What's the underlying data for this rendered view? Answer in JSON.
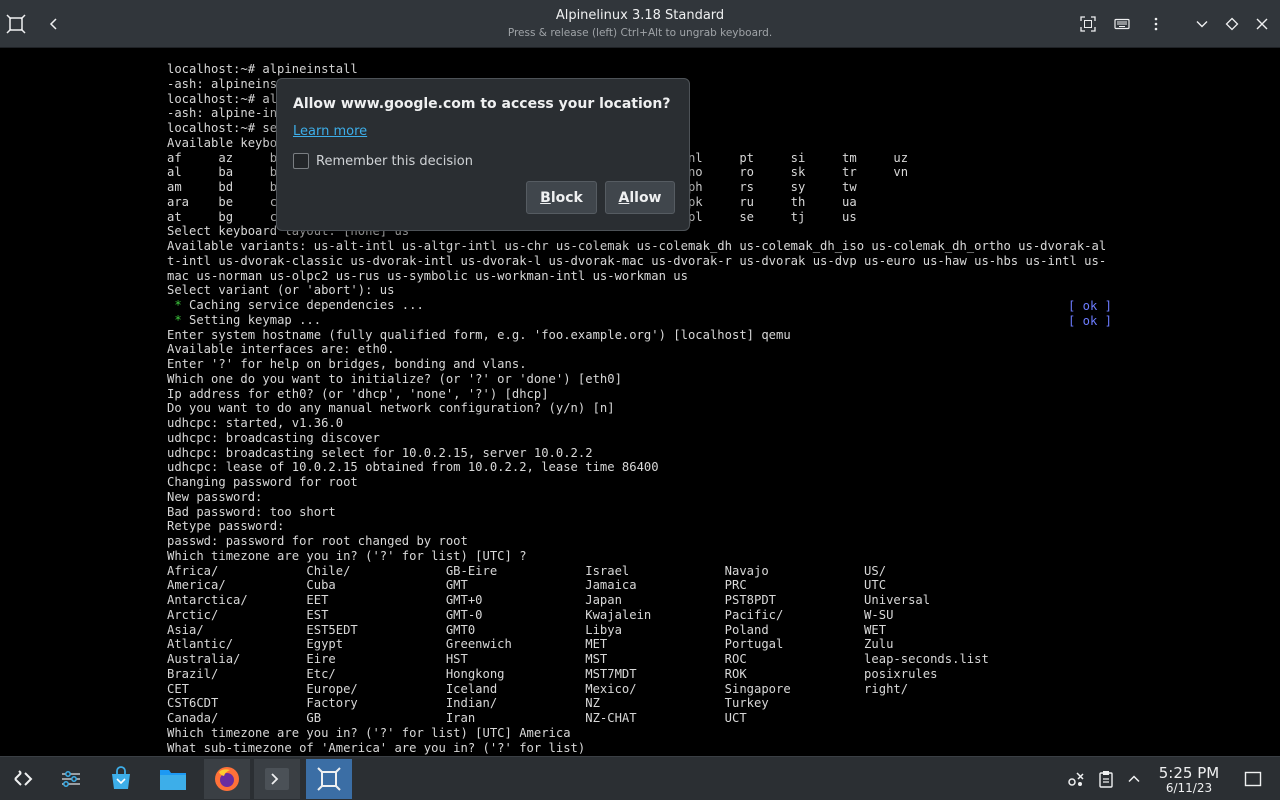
{
  "window": {
    "title": "Alpinelinux 3.18 Standard",
    "subtitle": "Press & release (left) Ctrl+Alt to ungrab keyboard."
  },
  "dialog": {
    "title": "Allow www.google.com to access your location?",
    "learn_more": "Learn more",
    "remember": "Remember this decision",
    "block_first": "B",
    "block_rest": "lock",
    "allow_first": "A",
    "allow_rest": "llow"
  },
  "terminal": {
    "lines": [
      "localhost:~# alpineinstall",
      "-ash: alpineins",
      "localhost:~# al",
      "-ash: alpine-in",
      "localhost:~# se",
      "Available keybo",
      "af     az     b                                           v     ml     nl     pt     si     tm     uz",
      "al     ba     b                                           a     mm     no     ro     sk     tr     vn",
      "am     bd     b                                           d     mt     ph     rs     sy     tw",
      "ara    be     c                                           e     my     pk     ru     th     ua",
      "at     bg     c                                           k     ng     pl     se     tj     us",
      "Select keyboard layout: [none] us",
      "Available variants: us-alt-intl us-altgr-intl us-chr us-colemak us-colemak_dh us-colemak_dh_iso us-colemak_dh_ortho us-dvorak-al",
      "t-intl us-dvorak-classic us-dvorak-intl us-dvorak-l us-dvorak-mac us-dvorak-r us-dvorak us-dvp us-euro us-haw us-hbs us-intl us-",
      "mac us-norman us-olpc2 us-rus us-symbolic us-workman-intl us-workman us",
      "Select variant (or 'abort'): us",
      "__STAR__ Caching service dependencies ...",
      "__STAR__ Setting keymap ...",
      "Enter system hostname (fully qualified form, e.g. 'foo.example.org') [localhost] qemu",
      "Available interfaces are: eth0.",
      "Enter '?' for help on bridges, bonding and vlans.",
      "Which one do you want to initialize? (or '?' or 'done') [eth0]",
      "Ip address for eth0? (or 'dhcp', 'none', '?') [dhcp]",
      "Do you want to do any manual network configuration? (y/n) [n]",
      "udhcpc: started, v1.36.0",
      "udhcpc: broadcasting discover",
      "udhcpc: broadcasting select for 10.0.2.15, server 10.0.2.2",
      "udhcpc: lease of 10.0.2.15 obtained from 10.0.2.2, lease time 86400",
      "Changing password for root",
      "New password:",
      "Bad password: too short",
      "Retype password:",
      "passwd: password for root changed by root",
      "Which timezone are you in? ('?' for list) [UTC] ?",
      "Africa/            Chile/             GB-Eire            Israel             Navajo             US/",
      "America/           Cuba               GMT                Jamaica            PRC                UTC",
      "Antarctica/        EET                GMT+0              Japan              PST8PDT            Universal",
      "Arctic/            EST                GMT-0              Kwajalein          Pacific/           W-SU",
      "Asia/              EST5EDT            GMT0               Libya              Poland             WET",
      "Atlantic/          Egypt              Greenwich          MET                Portugal           Zulu",
      "Australia/         Eire               HST                MST                ROC                leap-seconds.list",
      "Brazil/            Etc/               Hongkong           MST7MDT            ROK                posixrules",
      "CET                Europe/            Iceland            Mexico/            Singapore          right/",
      "CST6CDT            Factory            Indian/            NZ                 Turkey",
      "Canada/            GB                 Iran               NZ-CHAT            UCT",
      "Which timezone are you in? ('?' for list) [UTC] America",
      "What sub-timezone of 'America' are you in? ('?' for list)"
    ],
    "ok_label": "[ ok ]"
  },
  "taskbar": {
    "time": "5:25 PM",
    "date": "6/11/23"
  },
  "colors": {
    "accent": "#3daee9",
    "ok": "#6c7cff",
    "star": "#3ec93e"
  }
}
